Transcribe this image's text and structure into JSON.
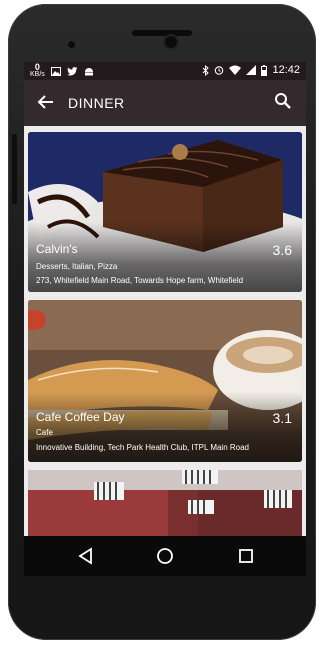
{
  "status_bar": {
    "kbs_value": "0",
    "kbs_unit": "KB/s",
    "time": "12:42",
    "icons": [
      "image-icon",
      "twitter-icon",
      "android-icon",
      "bluetooth-icon",
      "alarm-icon",
      "wifi-icon",
      "signal-icon",
      "battery-icon"
    ]
  },
  "app_bar": {
    "title": "DINNER",
    "back_icon": "back-arrow-icon",
    "search_icon": "search-icon"
  },
  "restaurants": [
    {
      "name": "Calvin's",
      "rating": "3.6",
      "cuisine": "Desserts, Italian, Pizza",
      "address": "273, Whitefield Main Road, Towards Hope farm, Whitefield"
    },
    {
      "name": "Cafe Coffee Day",
      "rating": "3.1",
      "cuisine": "Cafe",
      "address": "Innovative Building, Tech Park Health Club, ITPL Main Road"
    },
    {
      "name": "",
      "rating": "",
      "cuisine": "",
      "address": ""
    }
  ],
  "nav_bar": {
    "buttons": [
      "back-triangle-icon",
      "home-circle-icon",
      "recents-square-icon"
    ]
  },
  "colors": {
    "status_bar": "#231a1d",
    "app_bar": "#342a2d",
    "list_bg": "#ececec"
  }
}
